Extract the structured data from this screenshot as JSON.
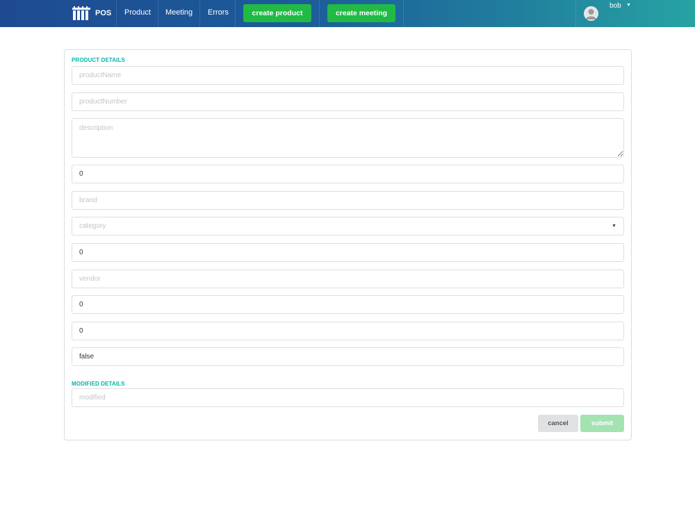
{
  "navbar": {
    "brand_icon": "columns-logo-icon",
    "brand": "POS",
    "links": [
      "Product",
      "Meeting",
      "Errors"
    ],
    "buttons": [
      "create product",
      "create meeting"
    ],
    "button_color": "#21ba45",
    "user": {
      "avatar_icon": "user-avatar-icon",
      "name": "bob",
      "caret_icon": "caret-down-icon"
    }
  },
  "form": {
    "product_section_label": "PRODUCT DETAILS",
    "fields": [
      {
        "placeholder": "productName",
        "value": ""
      },
      {
        "placeholder": "productNumber",
        "value": ""
      },
      {
        "placeholder": "description",
        "value": ""
      },
      {
        "placeholder": "",
        "value": "0"
      },
      {
        "placeholder": "brand",
        "value": ""
      },
      {
        "placeholder": "category",
        "value": ""
      },
      {
        "placeholder": "",
        "value": "0"
      },
      {
        "placeholder": "vendor",
        "value": ""
      },
      {
        "placeholder": "",
        "value": "0"
      },
      {
        "placeholder": "",
        "value": "0"
      },
      {
        "placeholder": "",
        "value": "false"
      }
    ],
    "modified_section_label": "MODIFIED DETAILS",
    "modified_field": {
      "placeholder": "modified",
      "value": ""
    },
    "cancel_label": "cancel",
    "submit_label": "submit",
    "section_label_color": "#00b5ad"
  }
}
